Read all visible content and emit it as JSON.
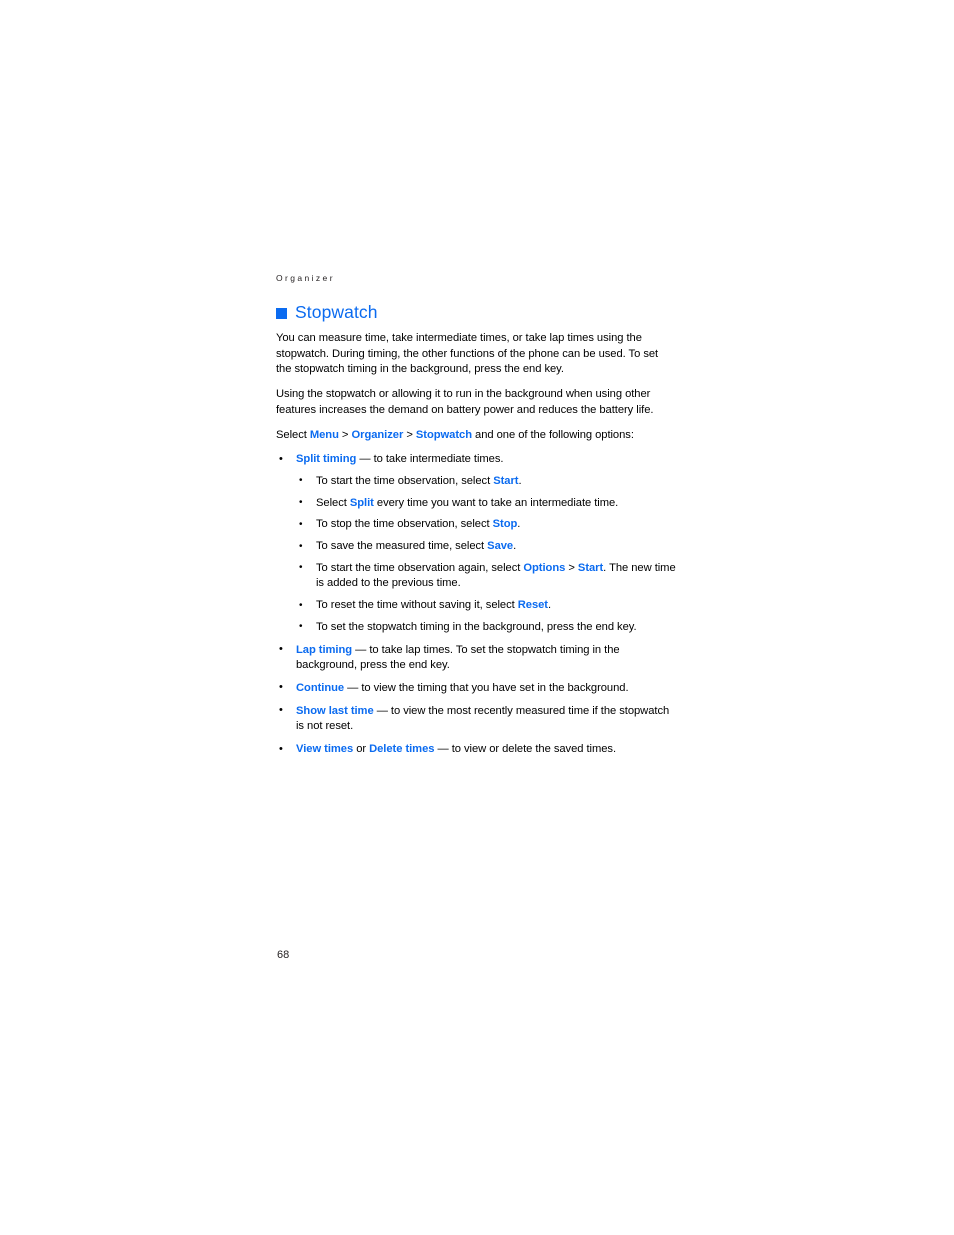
{
  "page": {
    "running_head": "Organizer",
    "folio": "68",
    "accent_color": "#0b6bf0",
    "text_color": "#000000",
    "background_color": "#ffffff"
  },
  "heading": {
    "marker": "square-bullet",
    "title": "Stopwatch"
  },
  "paragraphs": {
    "intro": "You can measure time, take intermediate times, or take lap times using the stopwatch. During timing, the other functions of the phone can be used. To set the stopwatch timing in the background, press the end key.",
    "note": "Using the stopwatch or allowing it to run in the background when using other features increases the demand on battery power and reduces the battery life."
  },
  "path_line": {
    "lead": "Select ",
    "menu": "Menu",
    "sep1": " > ",
    "organizer": "Organizer",
    "sep2": " > ",
    "stopwatch": "Stopwatch",
    "tail": " and one of the following options:"
  },
  "options": {
    "split_timing": {
      "term": "Split timing",
      "dash": " — ",
      "desc": "to take intermediate times.",
      "steps": [
        {
          "pre": "To start the time observation, select ",
          "term": "Start",
          "post": "."
        },
        {
          "pre": "Select ",
          "term": "Split",
          "post": " every time you want to take an intermediate time."
        },
        {
          "pre": "To stop the time observation, select ",
          "term": "Stop",
          "post": "."
        },
        {
          "pre": "To save the measured time, select ",
          "term": "Save",
          "post": "."
        },
        {
          "pre": "To start the time observation again, select ",
          "term": "Options",
          "sep": " > ",
          "term2": "Start",
          "post": ". The new time is added to the previous time."
        },
        {
          "pre": "To reset the time without saving it, select ",
          "term": "Reset",
          "post": "."
        },
        {
          "pre": "To set the stopwatch timing in the background, press the end key.",
          "term": "",
          "post": ""
        }
      ]
    },
    "lap_timing": {
      "term": "Lap timing",
      "dash": " — ",
      "desc": "to take lap times. To set the stopwatch timing in the background, press the end key."
    },
    "continue": {
      "term": "Continue",
      "dash": " — ",
      "desc": "to view the timing that you have set in the background."
    },
    "show_last_time": {
      "term": "Show last time",
      "dash": " — ",
      "desc": "to view the most recently measured time if the stopwatch is not reset."
    },
    "view_delete_times": {
      "term": "View times",
      "conj": " or ",
      "term2": "Delete times",
      "dash": " — ",
      "desc": "to view or delete the saved times."
    }
  }
}
